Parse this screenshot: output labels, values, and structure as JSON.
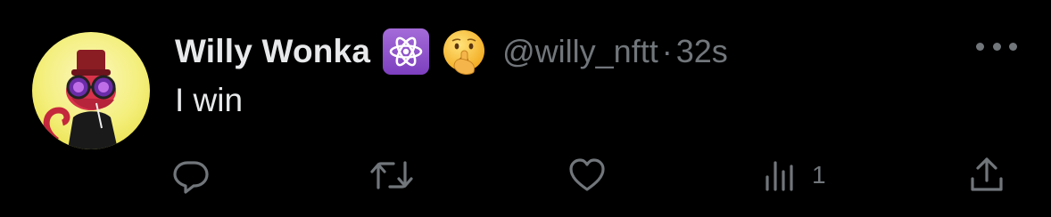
{
  "tweet": {
    "display_name": "Willy Wonka",
    "handle": "@willy_nftt",
    "separator": "·",
    "time": "32s",
    "text": "I win",
    "badges": [
      "atom-symbol-icon",
      "shushing-face-emoji"
    ],
    "actions": {
      "reply": {
        "icon": "reply-icon",
        "count": ""
      },
      "retweet": {
        "icon": "retweet-icon",
        "count": ""
      },
      "like": {
        "icon": "heart-icon",
        "count": ""
      },
      "views": {
        "icon": "views-chart-icon",
        "count": "1"
      },
      "share": {
        "icon": "share-icon",
        "count": ""
      }
    }
  },
  "colors": {
    "background": "#000000",
    "primary_text": "#e7e9ea",
    "secondary_text": "#71767b",
    "atom_badge": "#8e4fcf",
    "avatar_background": "#f6f29a"
  }
}
